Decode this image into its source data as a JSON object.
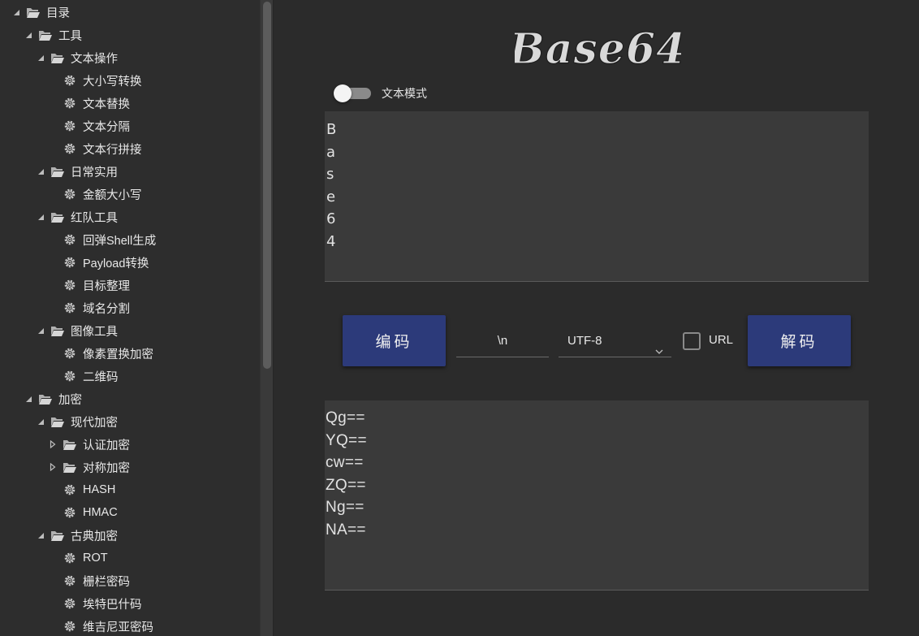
{
  "sidebar": {
    "items": [
      {
        "label": "目录",
        "icon": "folder-open-icon",
        "expander": "expanded"
      },
      {
        "label": "工具",
        "icon": "folder-open-icon",
        "expander": "expanded"
      },
      {
        "label": "文本操作",
        "icon": "folder-open-icon",
        "expander": "expanded"
      },
      {
        "label": "大小写转换",
        "icon": "gear-icon",
        "expander": "none"
      },
      {
        "label": "文本替换",
        "icon": "gear-icon",
        "expander": "none"
      },
      {
        "label": "文本分隔",
        "icon": "gear-icon",
        "expander": "none"
      },
      {
        "label": "文本行拼接",
        "icon": "gear-icon",
        "expander": "none"
      },
      {
        "label": "日常实用",
        "icon": "folder-open-icon",
        "expander": "expanded"
      },
      {
        "label": "金额大小写",
        "icon": "gear-icon",
        "expander": "none"
      },
      {
        "label": "红队工具",
        "icon": "folder-open-icon",
        "expander": "expanded"
      },
      {
        "label": "回弹Shell生成",
        "icon": "gear-icon",
        "expander": "none"
      },
      {
        "label": "Payload转换",
        "icon": "gear-icon",
        "expander": "none"
      },
      {
        "label": "目标整理",
        "icon": "gear-icon",
        "expander": "none"
      },
      {
        "label": "域名分割",
        "icon": "gear-icon",
        "expander": "none"
      },
      {
        "label": "图像工具",
        "icon": "folder-open-icon",
        "expander": "expanded"
      },
      {
        "label": "像素置换加密",
        "icon": "gear-icon",
        "expander": "none"
      },
      {
        "label": "二维码",
        "icon": "gear-icon",
        "expander": "none"
      },
      {
        "label": "加密",
        "icon": "folder-open-icon",
        "expander": "expanded"
      },
      {
        "label": "现代加密",
        "icon": "folder-open-icon",
        "expander": "expanded"
      },
      {
        "label": "认证加密",
        "icon": "folder-open-icon",
        "expander": "collapsed"
      },
      {
        "label": "对称加密",
        "icon": "folder-open-icon",
        "expander": "collapsed"
      },
      {
        "label": "HASH",
        "icon": "gear-icon",
        "expander": "none"
      },
      {
        "label": "HMAC",
        "icon": "gear-icon",
        "expander": "none"
      },
      {
        "label": "古典加密",
        "icon": "folder-open-icon",
        "expander": "expanded"
      },
      {
        "label": "ROT",
        "icon": "gear-icon",
        "expander": "none"
      },
      {
        "label": "栅栏密码",
        "icon": "gear-icon",
        "expander": "none"
      },
      {
        "label": "埃特巴什码",
        "icon": "gear-icon",
        "expander": "none"
      },
      {
        "label": "维吉尼亚密码",
        "icon": "gear-icon",
        "expander": "none"
      }
    ]
  },
  "main": {
    "logo_text": "Base64",
    "text_mode_label": "文本模式",
    "text_mode_on": false,
    "input_lines": [
      "B",
      "a",
      "s",
      "e",
      "6",
      "4"
    ],
    "encode_label": "编码",
    "separator_value": "\\n",
    "charset_value": "UTF-8",
    "url_label": "URL",
    "url_checked": false,
    "decode_label": "解码",
    "output_lines": [
      "Qg==",
      "YQ==",
      "cw==",
      "ZQ==",
      "Ng==",
      "NA=="
    ]
  },
  "colors": {
    "background": "#2b2b2b",
    "sidebar": "#2d2d2d",
    "textarea": "#3a3a3a",
    "button": "#2c3a7a",
    "text": "#e6e6e6"
  }
}
